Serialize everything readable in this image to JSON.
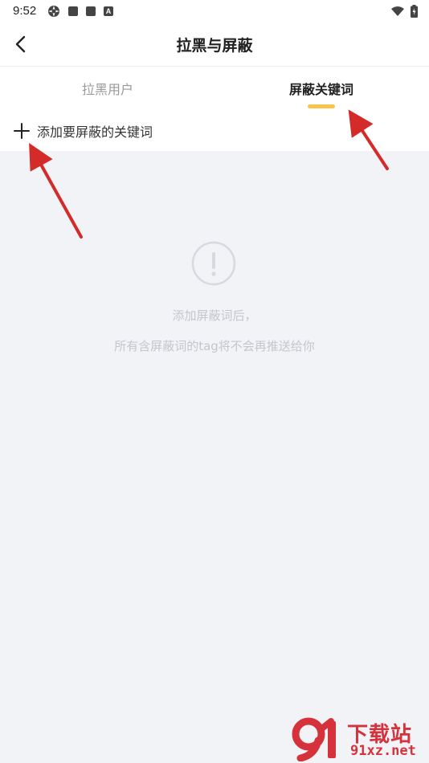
{
  "status_bar": {
    "time": "9:52",
    "notification_letter": "A"
  },
  "nav": {
    "title": "拉黑与屏蔽"
  },
  "tabs": [
    {
      "label": "拉黑用户",
      "active": false
    },
    {
      "label": "屏蔽关键词",
      "active": true
    }
  ],
  "add_row": {
    "label": "添加要屏蔽的关键词"
  },
  "empty_state": {
    "line1": "添加屏蔽词后，",
    "line2": "所有含屏蔽词的tag将不会再推送给你"
  },
  "watermark": {
    "text": "下载站",
    "domain": "91xz.net"
  },
  "colors": {
    "accent": "#f9c44a",
    "background": "#f2f3f7",
    "annotation_arrow": "#d42a2a"
  }
}
